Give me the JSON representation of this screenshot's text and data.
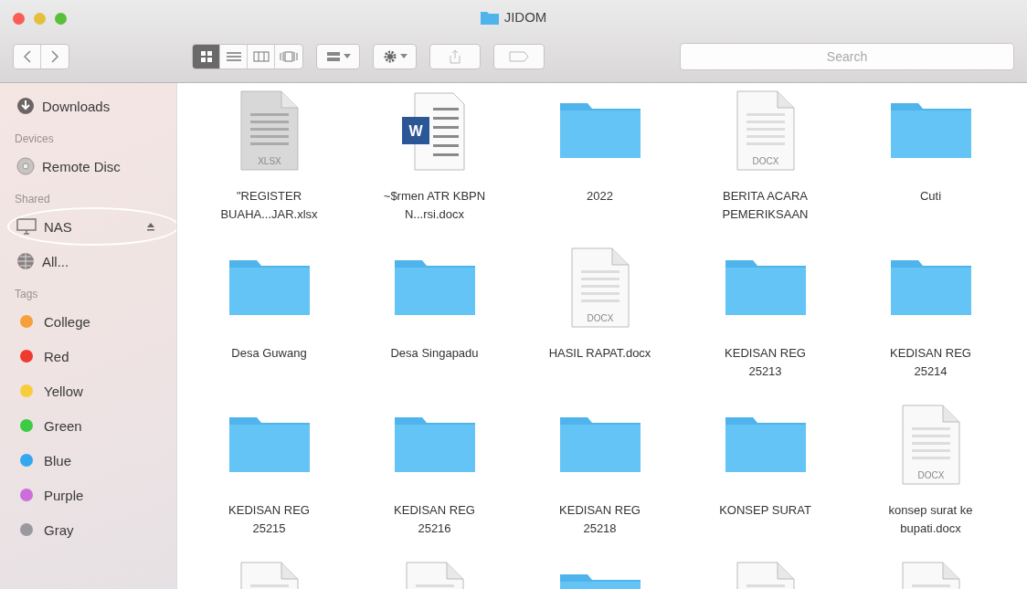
{
  "window": {
    "title": "JIDOM"
  },
  "toolbar": {
    "views": [
      {
        "kind": "icon",
        "selected": true
      },
      {
        "kind": "list",
        "selected": false
      },
      {
        "kind": "column",
        "selected": false
      },
      {
        "kind": "cover",
        "selected": false
      }
    ],
    "search": {
      "placeholder": "Search"
    }
  },
  "sidebar": {
    "sections": [
      {
        "items": [
          {
            "label": "Downloads",
            "kind": "download"
          }
        ]
      },
      {
        "header": "Devices",
        "items": [
          {
            "label": "Remote Disc",
            "kind": "disc"
          }
        ]
      },
      {
        "header": "Shared",
        "items": [
          {
            "label": "NAS",
            "kind": "server",
            "eject": true,
            "circled": true
          },
          {
            "label": "All...",
            "kind": "network"
          }
        ]
      },
      {
        "header": "Tags",
        "items": [
          {
            "label": "College",
            "kind": "tag",
            "color": "#f5a03a"
          },
          {
            "label": "Red",
            "kind": "tag",
            "color": "#f03a2e"
          },
          {
            "label": "Yellow",
            "kind": "tag",
            "color": "#f7cd3b"
          },
          {
            "label": "Green",
            "kind": "tag",
            "color": "#3ccb45"
          },
          {
            "label": "Blue",
            "kind": "tag",
            "color": "#33a8ee"
          },
          {
            "label": "Purple",
            "kind": "tag",
            "color": "#cc6ddb"
          },
          {
            "label": "Gray",
            "kind": "tag",
            "color": "#9a9a9e"
          }
        ]
      }
    ]
  },
  "files": [
    {
      "name": "\"REGISTER BUAHA...JAR.xlsx",
      "kind": "sheet",
      "badge": "XLSX"
    },
    {
      "name": "~$rmen ATR KBPN N...rsi.docx",
      "kind": "word",
      "badge": "W"
    },
    {
      "name": "2022",
      "kind": "folder"
    },
    {
      "name": "BERITA ACARA PEMERIKSAAN",
      "kind": "doc",
      "badge": "DOCX"
    },
    {
      "name": "Cuti",
      "kind": "folder"
    },
    {
      "name": "Desa Guwang",
      "kind": "folder"
    },
    {
      "name": "Desa Singapadu",
      "kind": "folder"
    },
    {
      "name": "HASIL RAPAT.docx",
      "kind": "doc",
      "badge": "DOCX"
    },
    {
      "name": "KEDISAN REG 25213",
      "kind": "folder"
    },
    {
      "name": "KEDISAN REG 25214",
      "kind": "folder"
    },
    {
      "name": "KEDISAN REG 25215",
      "kind": "folder"
    },
    {
      "name": "KEDISAN REG 25216",
      "kind": "folder"
    },
    {
      "name": "KEDISAN REG 25218",
      "kind": "folder"
    },
    {
      "name": "KONSEP SURAT",
      "kind": "folder"
    },
    {
      "name": "konsep surat ke bupati.docx",
      "kind": "doc",
      "badge": "DOCX"
    },
    {
      "kind": "doc"
    },
    {
      "kind": "doc"
    },
    {
      "kind": "folder"
    },
    {
      "kind": "doc"
    },
    {
      "kind": "doc"
    }
  ]
}
